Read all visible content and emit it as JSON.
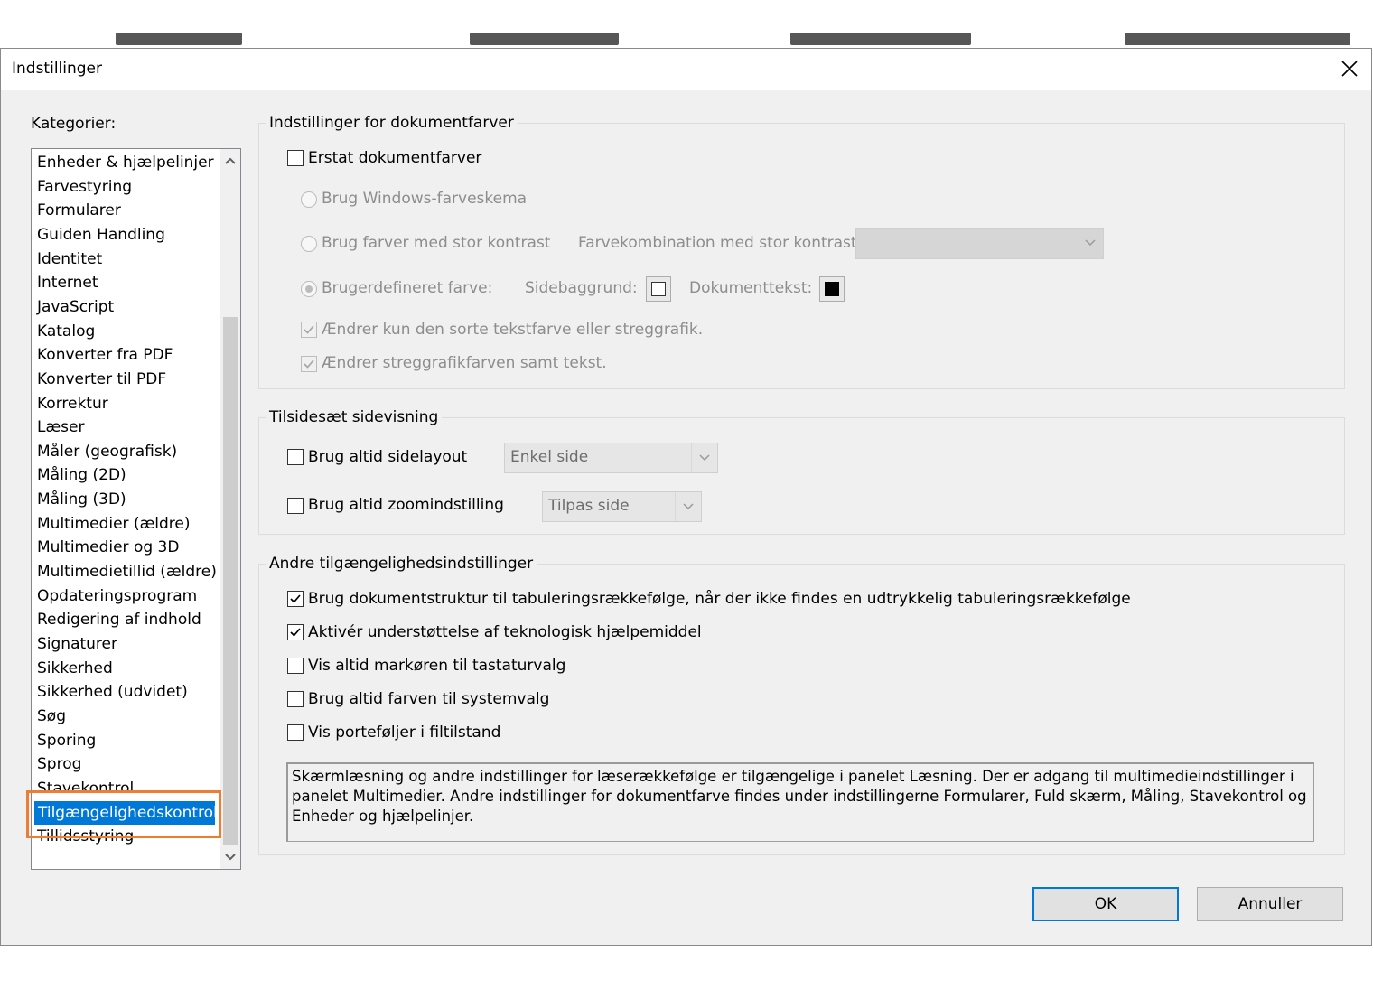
{
  "dialog": {
    "title": "Indstillinger"
  },
  "categories": {
    "label": "Kategorier:",
    "items": [
      "Enheder & hjælpelinjer",
      "Farvestyring",
      "Formularer",
      "Guiden Handling",
      "Identitet",
      "Internet",
      "JavaScript",
      "Katalog",
      "Konverter fra PDF",
      "Konverter til PDF",
      "Korrektur",
      "Læser",
      "Måler (geografisk)",
      "Måling (2D)",
      "Måling (3D)",
      "Multimedier (ældre)",
      "Multimedier og 3D",
      "Multimedietillid (ældre)",
      "Opdateringsprogram",
      "Redigering af indhold",
      "Signaturer",
      "Sikkerhed",
      "Sikkerhed (udvidet)",
      "Søg",
      "Sporing",
      "Sprog",
      "Stavekontrol",
      "Tilgængelighedskontrol",
      "Tillidsstyring"
    ],
    "selected": "Tilgængelighedskontrol"
  },
  "colors": {
    "selection": "#0078d7",
    "highlight_outline": "#ed7d31",
    "disabled_text": "#8d8d8d"
  },
  "doc_colors": {
    "title": "Indstillinger for dokumentfarver",
    "replace_label": "Erstat dokumentfarver",
    "replace_checked": false,
    "windows_scheme_label": "Brug Windows-farveskema",
    "high_contrast_label": "Brug farver med stor kontrast",
    "high_contrast_combo_label": "Farvekombination med stor kontrast:",
    "high_contrast_combo_value": "",
    "custom_label": "Brugerdefineret farve:",
    "custom_selected": true,
    "page_bg_label": "Sidebaggrund:",
    "page_bg_color": "#ffffff",
    "doc_text_label": "Dokumenttekst:",
    "doc_text_color": "#000000",
    "only_black_label": "Ændrer kun den sorte tekstfarve eller streggrafik.",
    "only_black_checked": true,
    "line_art_label": "Ændrer streggrafikfarven samt tekst.",
    "line_art_checked": true
  },
  "page_display": {
    "title": "Tilsidesæt sidevisning",
    "layout_label": "Brug altid sidelayout",
    "layout_checked": false,
    "layout_value": "Enkel side",
    "zoom_label": "Brug altid zoomindstilling",
    "zoom_checked": false,
    "zoom_value": "Tilpas side"
  },
  "other": {
    "title": "Andre tilgængelighedsindstillinger",
    "options": [
      {
        "label": "Brug dokumentstruktur til tabuleringsrækkefølge, når der ikke findes en udtrykkelig tabuleringsrækkefølge",
        "checked": true
      },
      {
        "label": "Aktivér understøttelse af teknologisk hjælpemiddel",
        "checked": true
      },
      {
        "label": "Vis altid markøren til tastaturvalg",
        "checked": false
      },
      {
        "label": "Brug altid farven til systemvalg",
        "checked": false
      },
      {
        "label": "Vis porteføljer i filtilstand",
        "checked": false
      }
    ],
    "info_text": "Skærmlæsning og andre indstillinger for læserækkefølge er tilgængelige i panelet Læsning. Der er adgang til multimedieindstillinger i panelet Multimedier. Andre indstillinger for dokumentfarve findes under indstillingerne Formularer, Fuld skærm, Måling, Stavekontrol og Enheder og hjælpelinjer."
  },
  "buttons": {
    "ok": "OK",
    "cancel": "Annuller"
  }
}
